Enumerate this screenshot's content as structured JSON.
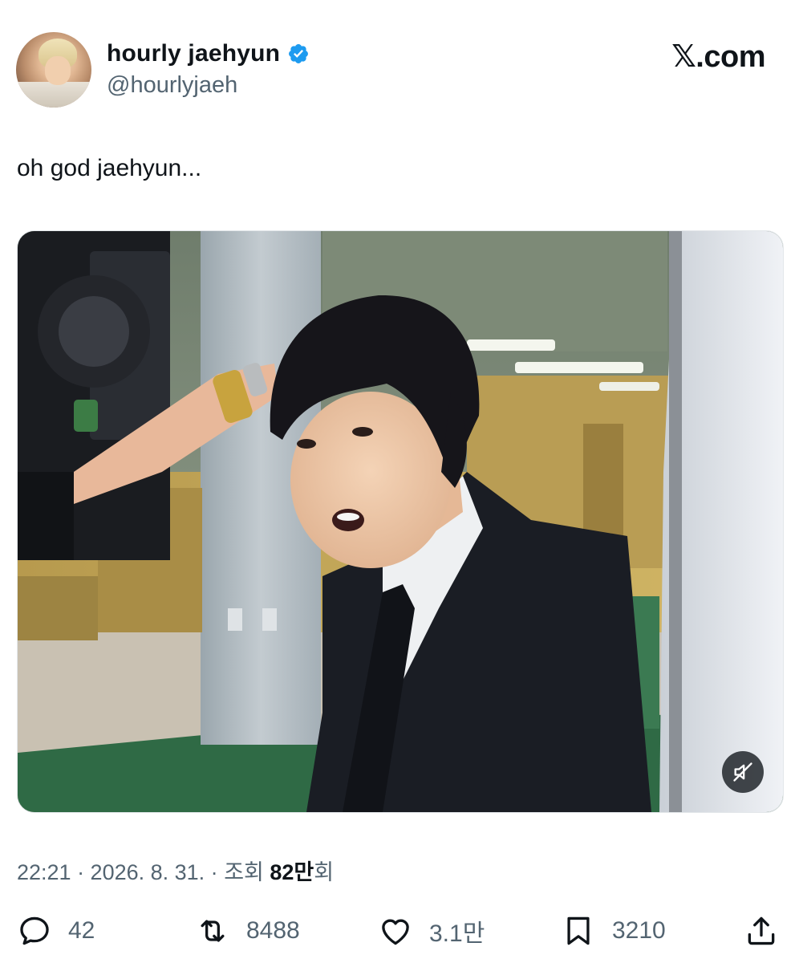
{
  "author": {
    "display_name": "hourly jaehyun",
    "handle": "@hourlyjaeh",
    "verified_color": "#1d9bf0"
  },
  "brand": "𝕏.com",
  "tweet": {
    "text": "oh god jaehyun..."
  },
  "meta": {
    "time_date": "22:21 · 2026. 8. 31. · ",
    "views_label": "조회 ",
    "views_count": "82만",
    "views_suffix": "회"
  },
  "actions": {
    "replies": "42",
    "reposts": "8488",
    "likes": "3.1만",
    "bookmarks": "3210"
  },
  "icons": [
    "reply-icon",
    "repost-icon",
    "like-icon",
    "bookmark-icon",
    "share-icon",
    "verified-badge-icon",
    "muted-speaker-icon"
  ]
}
